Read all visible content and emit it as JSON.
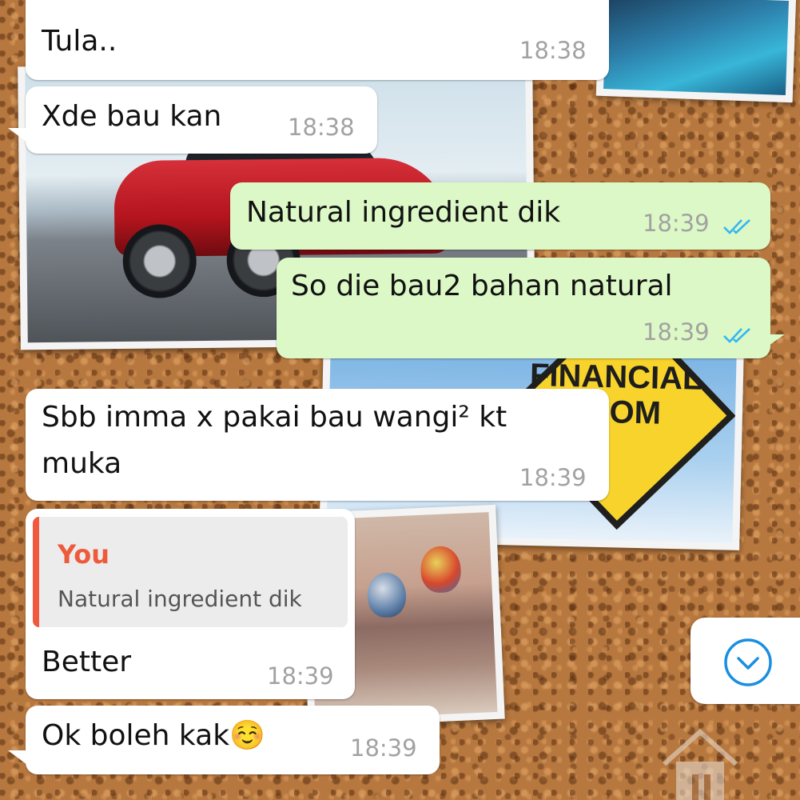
{
  "messages": [
    {
      "text": "Tula..",
      "time": "18:38",
      "direction": "incoming"
    },
    {
      "text": "Xde bau kan",
      "time": "18:38",
      "direction": "incoming"
    },
    {
      "text": "Natural ingredient dik",
      "time": "18:39",
      "direction": "outgoing",
      "status": "read"
    },
    {
      "text": "So die bau2 bahan natural",
      "time": "18:39",
      "direction": "outgoing",
      "status": "read"
    },
    {
      "line1": "Sbb imma x pakai bau wangi² kt",
      "line2": "muka",
      "time": "18:39",
      "direction": "incoming"
    },
    {
      "quote": {
        "author": "You",
        "text": "Natural ingredient dik"
      },
      "text": "Better",
      "time": "18:39",
      "direction": "incoming"
    },
    {
      "text": "Ok boleh kak☺️",
      "time": "18:39",
      "direction": "incoming"
    }
  ],
  "wallpaper": {
    "sign_line1": "FINANCIAL",
    "sign_line2": "EDOM"
  },
  "controls": {
    "scroll_icon": "chevron-down-circle-icon"
  },
  "colors": {
    "incoming_bubble": "#ffffff",
    "outgoing_bubble": "#dcf8c6",
    "read_ticks": "#34b7f1",
    "quote_accent": "#ed5b3c",
    "timestamp": "#a2a2a2",
    "scroll_icon": "#1a8fe0"
  }
}
